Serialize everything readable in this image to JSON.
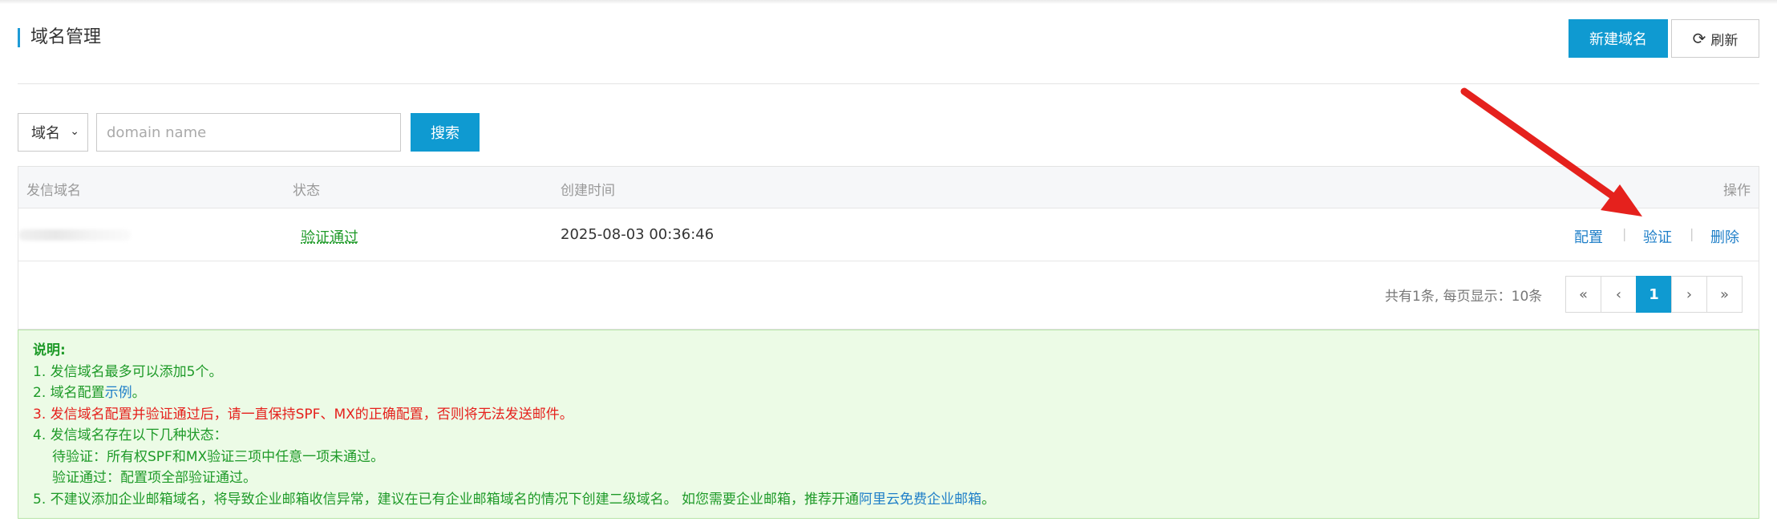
{
  "header": {
    "title": "域名管理",
    "new_button": "新建域名",
    "refresh_button": "刷新"
  },
  "search": {
    "field_select": "域名",
    "placeholder": "domain name",
    "value": "",
    "button": "搜索"
  },
  "table": {
    "columns": [
      "发信域名",
      "状态",
      "创建时间",
      "操作"
    ],
    "rows": [
      {
        "domain": "",
        "status": "验证通过",
        "created": "2025-08-03 00:36:46",
        "actions": [
          "配置",
          "验证",
          "删除"
        ]
      }
    ]
  },
  "pagination": {
    "info": "共有1条, 每页显示：10条",
    "first": "«",
    "prev": "‹",
    "current": "1",
    "next": "›",
    "last": "»"
  },
  "notice": {
    "heading": "说明:",
    "line1": "1. 发信域名最多可以添加5个。",
    "line2_prefix": "2. 域名配置",
    "line2_link": "示例",
    "line2_suffix": "。",
    "line3": "3. 发信域名配置并验证通过后，请一直保持SPF、MX的正确配置，否则将无法发送邮件。",
    "line4": "4. 发信域名存在以下几种状态：",
    "line4a": "待验证：所有权SPF和MX验证三项中任意一项未通过。",
    "line4b": "验证通过：配置项全部验证通过。",
    "line5_prefix": "5. 不建议添加企业邮箱域名，将导致企业邮箱收信异常，建议在已有企业邮箱域名的情况下创建二级域名。 如您需要企业邮箱，推荐开通",
    "line5_link": "阿里云免费企业邮箱",
    "line5_suffix": "。"
  },
  "colors": {
    "primary": "#0f9ad1",
    "success": "#1e9a28",
    "danger": "#e5211d",
    "link": "#1f7fc8",
    "annotation_arrow": "#e5211d"
  }
}
